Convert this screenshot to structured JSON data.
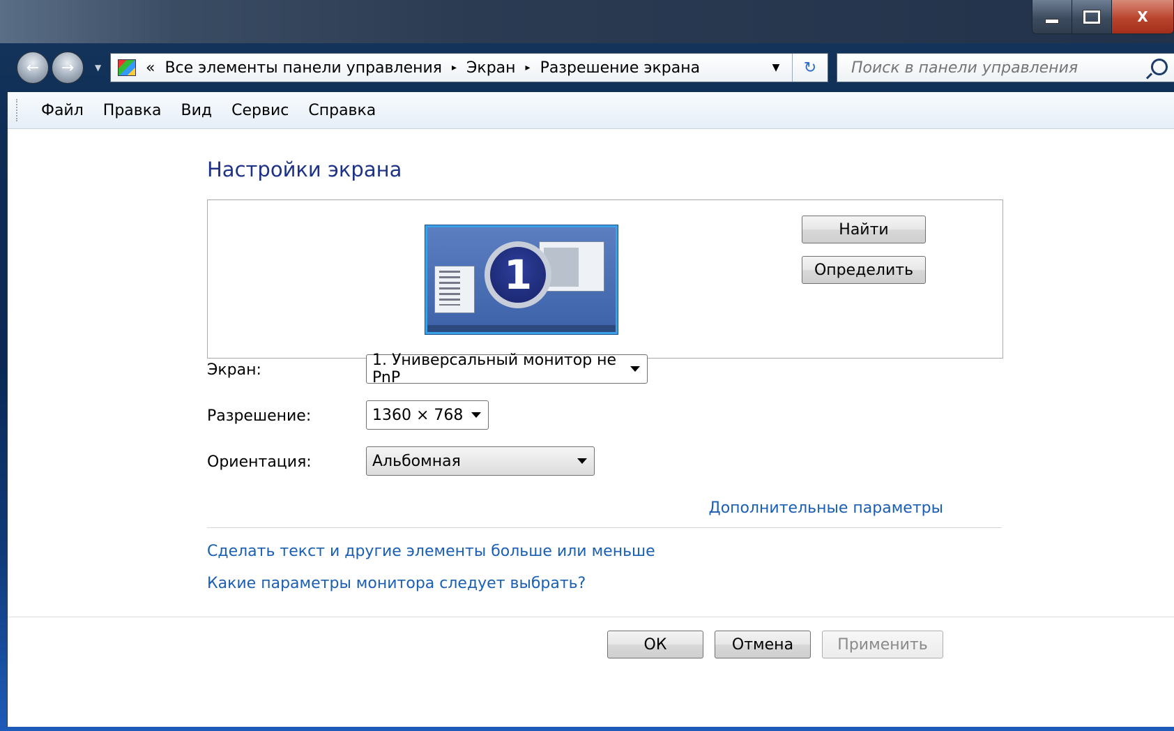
{
  "window": {
    "controls": {
      "minimize_icon": "minimize-icon",
      "maximize_icon": "maximize-icon",
      "close_glyph": "X"
    }
  },
  "navigation": {
    "back_icon": "back-arrow-icon",
    "forward_icon": "forward-arrow-icon",
    "address": {
      "overflow": "«",
      "crumbs": [
        "Все элементы панели управления",
        "Экран",
        "Разрешение экрана"
      ],
      "separator": "▸"
    },
    "search": {
      "placeholder": "Поиск в панели управления"
    }
  },
  "menubar": {
    "items": [
      "Файл",
      "Правка",
      "Вид",
      "Сервис",
      "Справка"
    ]
  },
  "main": {
    "heading": "Настройки экрана",
    "monitor": {
      "number": "1"
    },
    "buttons": {
      "find": "Найти",
      "identify": "Определить"
    },
    "fields": {
      "display": {
        "label": "Экран:",
        "value": "1. Универсальный монитор не PnP"
      },
      "resolution": {
        "label": "Разрешение:",
        "value": "1360 × 768"
      },
      "orientation": {
        "label": "Ориентация:",
        "value": "Альбомная"
      }
    },
    "advanced_link": "Дополнительные параметры",
    "links": [
      "Сделать текст и другие элементы больше или меньше",
      "Какие параметры монитора следует выбрать?"
    ]
  },
  "footer": {
    "ok": "ОК",
    "cancel": "Отмена",
    "apply": "Применить"
  },
  "colors": {
    "heading": "#1e3287",
    "link": "#1a5fb4"
  }
}
